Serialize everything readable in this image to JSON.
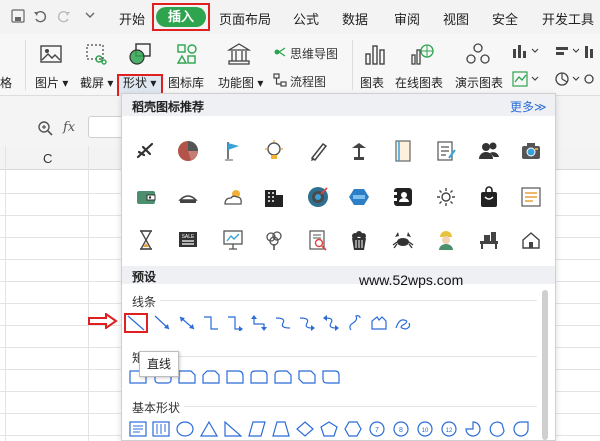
{
  "menubar": {
    "tabs": [
      "开始",
      "插入",
      "页面布局",
      "公式",
      "数据",
      "审阅",
      "视图",
      "安全",
      "开发工具"
    ],
    "active_tab": "插入",
    "active_color": "#2ea44f"
  },
  "ribbon": {
    "partial_label": "格",
    "picture": "图片",
    "screenshot": "截屏",
    "shapes": "形状",
    "icon_library": "图标库",
    "function_chart": "功能图",
    "mind_map": "思维导图",
    "flowchart": "流程图",
    "chart": "图表",
    "online_chart": "在线图表",
    "demo_chart": "演示图表"
  },
  "formula_bar": {
    "fx": "fx"
  },
  "sheet": {
    "column_header": "C"
  },
  "panel": {
    "title": "稻壳图标推荐",
    "more": "更多",
    "more_arrow": "≫",
    "icon_rows": [
      [
        "airplane-icon",
        "pie-chart-icon",
        "flag-icon",
        "lightbulb-icon",
        "pen-icon",
        "lamp-icon",
        "document-icon",
        "notepad-icon",
        "users-icon",
        "camera-icon"
      ],
      [
        "wallet-icon",
        "bread-icon",
        "cloud-sun-icon",
        "building-icon",
        "target-icon",
        "hexagon-tag-icon",
        "contact-card-icon",
        "sun-icon",
        "shopping-bag-icon",
        "text-list-icon"
      ],
      [
        "hourglass-icon",
        "sale-sign-icon",
        "presentation-icon",
        "tree-icon",
        "document-search-icon",
        "popcorn-icon",
        "crab-icon",
        "worker-icon",
        "desk-icon",
        "house-icon"
      ]
    ],
    "preset": "预设",
    "watermark": "www.52wps.com",
    "lines_label": "线条",
    "rect_label": "矩形",
    "basic_label": "基本形状",
    "tooltip": "直线",
    "accent": "#2b6cd8",
    "highlight": "#e02020"
  }
}
